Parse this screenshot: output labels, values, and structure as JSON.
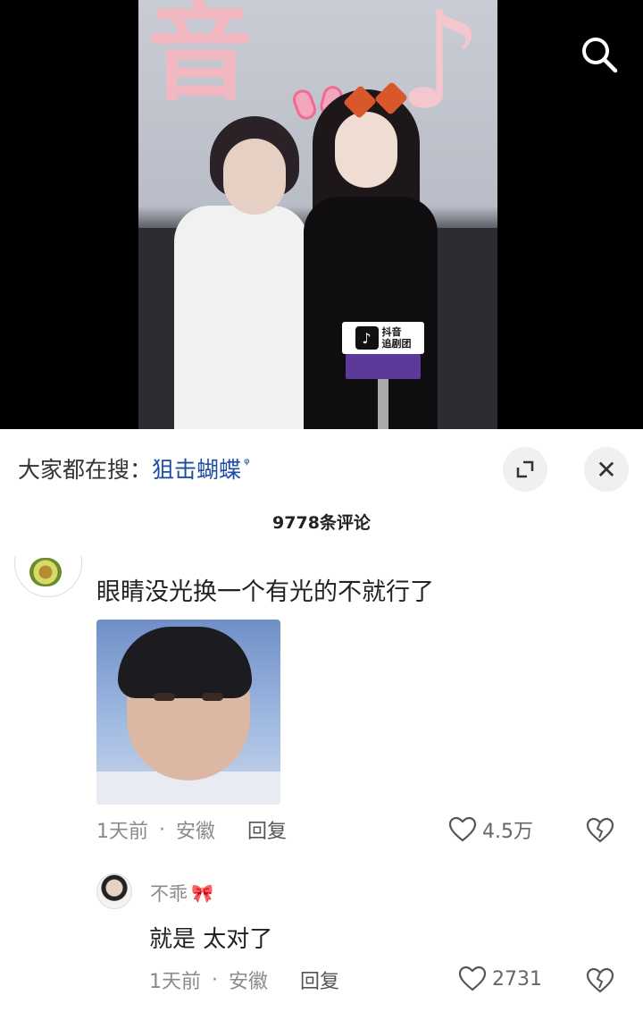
{
  "video": {
    "backdrop_char": "音",
    "mic_card_line1": "抖音",
    "mic_card_line2": "追剧团"
  },
  "icons": {
    "search": "search-icon",
    "expand": "expand-icon",
    "close": "close-icon",
    "like": "heart-icon",
    "dislike": "broken-heart-icon"
  },
  "search_suggestion": {
    "prefix": "大家都在搜：",
    "term": "狙击蝴蝶",
    "mini_icon": "ᵠ"
  },
  "sheet": {
    "close_glyph": "✕",
    "comment_count": "9778条评论"
  },
  "comments": [
    {
      "text": "眼睛没光换一个有光的不就行了",
      "time": "1天前",
      "location": "安徽",
      "reply_label": "回复",
      "likes": "4.5万"
    }
  ],
  "replies": [
    {
      "username": "不乖",
      "name_emoji": "🎀",
      "text": "就是 太对了",
      "time": "1天前",
      "location": "安徽",
      "reply_label": "回复",
      "likes": "2731"
    }
  ],
  "separator": "·",
  "colors": {
    "link_blue": "#1d4ea3",
    "meta_gray": "#8a8a8a",
    "button_bg": "#f0f0f2"
  }
}
